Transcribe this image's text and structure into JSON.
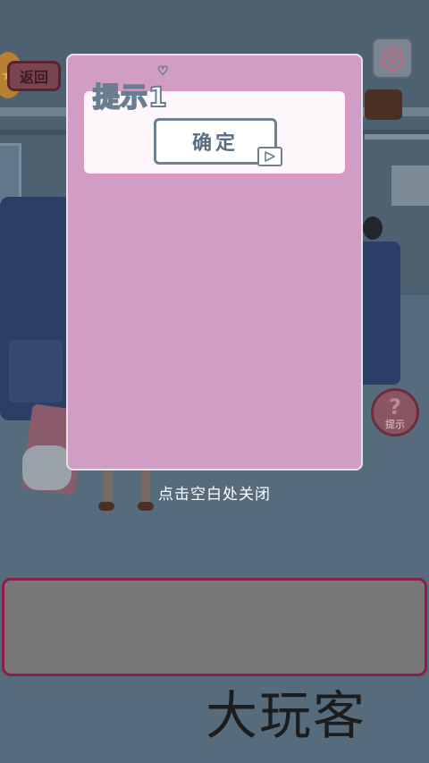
{
  "top_bar": {
    "back_label": "返回",
    "coin_glyph": "★"
  },
  "hint_button": {
    "icon": "?",
    "label": "提示"
  },
  "modal": {
    "title": "提示1",
    "heart": "♡",
    "confirm_label": "确定",
    "video_icon": "play-video-icon"
  },
  "close_hint": "点击空白处关闭",
  "watermark": "大玩客",
  "colors": {
    "modal_bg": "#d29dc5",
    "card_border": "#e990c4",
    "answer_border": "#8c1e4a"
  }
}
